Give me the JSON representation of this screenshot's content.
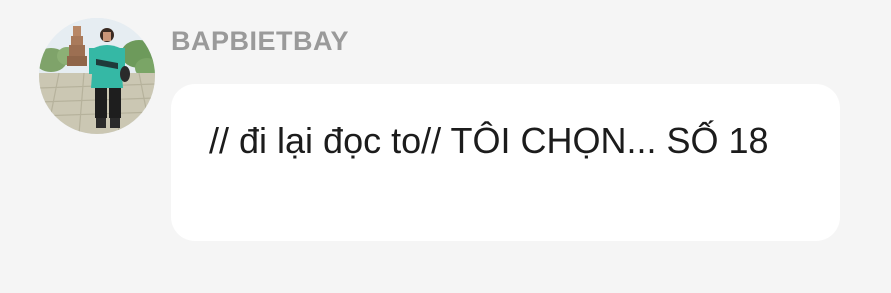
{
  "comment": {
    "username": "BAPBIETBAY",
    "message": "// đi lại đọc to// TÔI CHỌN... SỐ 18",
    "avatar_icon": "user-avatar-photo"
  }
}
